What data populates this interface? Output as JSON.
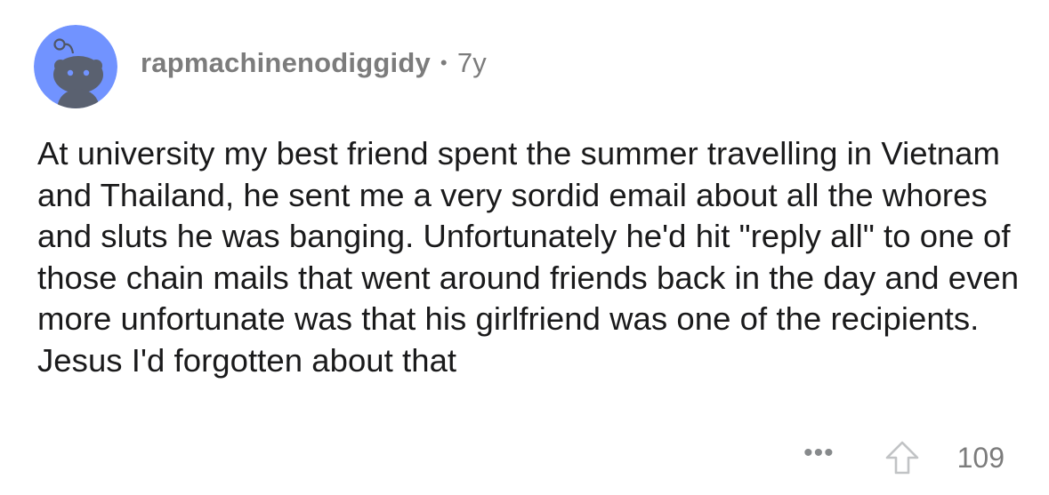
{
  "comment": {
    "author": "rapmachinenodiggidy",
    "separator": "•",
    "age": "7y",
    "text": "At university my best friend spent the summer travelling in Vietnam and Thailand, he sent me a very sordid email about all the whores and sluts he was banging. Unfortunately he'd hit \"reply all\" to one of those chain mails that went around friends back in the day and even more unfortunate was that his girlfriend was one of the recipients. Jesus I'd forgotten about that",
    "more_label": "•••",
    "score": "109"
  },
  "icons": {
    "avatar": "snoo-avatar-icon",
    "upvote": "upvote-arrow-icon",
    "more": "more-options-icon"
  },
  "colors": {
    "avatar_bg": "#7193ff",
    "snoo_body": "#5a6170",
    "meta_text": "#7c7c7c",
    "body_text": "#1a1a1b"
  }
}
